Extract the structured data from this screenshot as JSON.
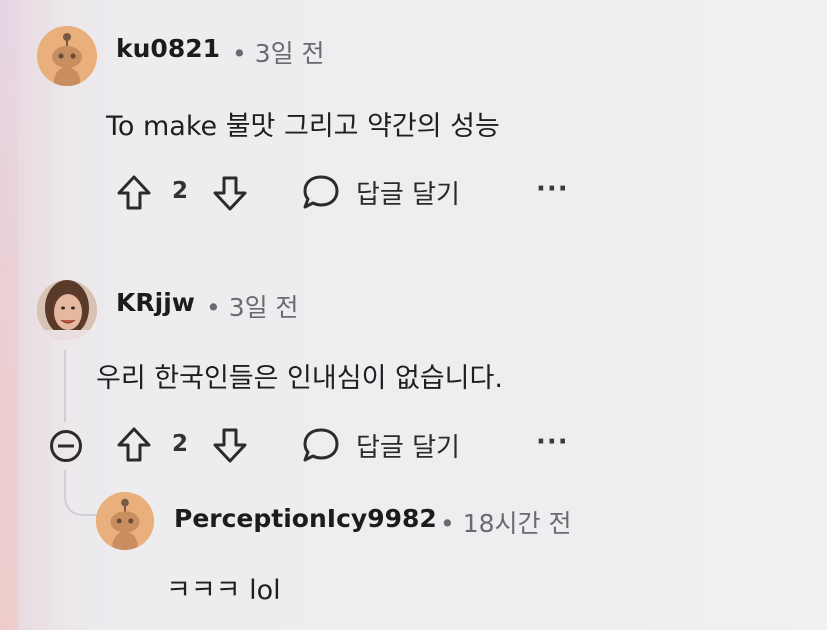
{
  "comments": [
    {
      "username": "ku0821",
      "meta": "• 3일 전",
      "text": "To make 불맛 그리고 약간의 성능",
      "votes": "2",
      "reply_label": "답글 달기",
      "more_label": "···"
    },
    {
      "username": "KRjjw",
      "meta": "• 3일 전",
      "text": "우리 한국인들은 인내심이 없습니다.",
      "votes": "2",
      "reply_label": "답글 달기",
      "more_label": "···"
    },
    {
      "username": "PerceptionIcy9982",
      "meta": "• 18시간 전",
      "text": "ㅋㅋㅋ lol"
    }
  ],
  "icons": {
    "upvote": "upvote-icon",
    "downvote": "downvote-icon",
    "reply": "reply-bubble-icon",
    "collapse": "collapse-thread-icon",
    "more": "more-options-icon"
  },
  "colors": {
    "snoo_avatar": "#e9b07e",
    "text_primary": "#1c1c1e",
    "text_secondary": "#6b6b6f"
  }
}
